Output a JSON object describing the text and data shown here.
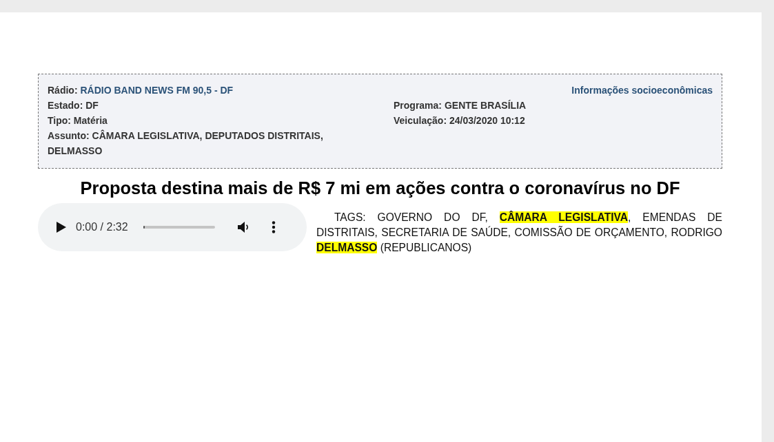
{
  "info": {
    "left": [
      {
        "label": "Rádio:",
        "value": "RÁDIO BAND NEWS FM 90,5 - DF",
        "link": true
      },
      {
        "text": "Estado: DF",
        "link": false
      },
      {
        "text": "Tipo: Matéria",
        "link": false
      },
      {
        "text": "Assunto: CÂMARA LEGISLATIVA, DEPUTADOS DISTRITAIS, DELMASSO",
        "link": false
      }
    ],
    "link": "Informações socioeconômicas",
    "right": [
      {
        "text": "Programa: GENTE BRASÍLIA",
        "link": false
      },
      {
        "text": "Veiculação: 24/03/2020 10:12",
        "link": false
      }
    ]
  },
  "headline": "Proposta destina mais de R$ 7 mi em ações contra o coronavírus no DF",
  "player": {
    "time": "0:00 / 2:32",
    "level": 0.02
  },
  "tags": "TAGS: GOVERNO DO DF, **CÂMARA LEGISLATIVA**, EMENDAS DE DISTRITAIS, SECRETARIA DE SAÚDE, COMISSÃO DE ORÇAMENTO, RODRIGO **DELMASSO** (REPUBLICANOS)"
}
